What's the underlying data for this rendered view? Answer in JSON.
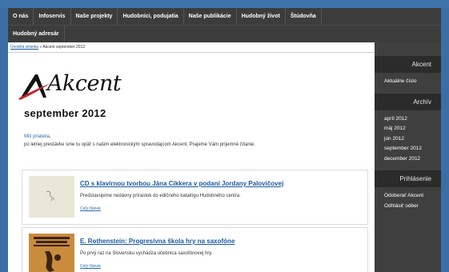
{
  "nav": {
    "row1": [
      "O nás",
      "Infoservis",
      "Naše projekty",
      "Hudobníci, podujatia",
      "Naše publikácie",
      "Hudobný život",
      "Štúdovňa"
    ],
    "row2": [
      "Hudobný adresár"
    ]
  },
  "breadcrumb": {
    "home": "Úvodná stránka",
    "separator": "»",
    "current": "Akcent september 2012"
  },
  "logo": {
    "text": "Akcent"
  },
  "issue_title": "september 2012",
  "intro": {
    "greeting": "Milí priatelia,",
    "text": "po letnej prestávke sme tu opäť s našim elektronickým spravodajcom Akcent. Prajeme Vám príjemné čítanie."
  },
  "articles": [
    {
      "title": "CD s klavírnou tvorbou Jána Cikkera v podaní Jordany Palovičovej",
      "desc": "Predstavujeme nedávny prírastok do edičného katalógu Hudobného centra.",
      "more": "Celý článok"
    },
    {
      "title": "E. Rothenstein: Progresívna škola hry na saxofóne",
      "desc": "Po prvý raz na Slovensku vychádza učebnica saxofónovej hry.",
      "more": "Celý článok"
    }
  ],
  "sidebar": {
    "current_header": "Akcent",
    "current_link": "Aktuálne číslo",
    "archive_header": "Archív",
    "archive_links": [
      "apríl 2012",
      "máj 2012",
      "jún 2012",
      "september 2012",
      "december 2012"
    ],
    "login_header": "Prihlásenie",
    "login_links": [
      "Odoberať Akcent",
      "Odhlásiť odber"
    ]
  },
  "colors": {
    "nav_bg": "#3c3c3c",
    "sidebar_bg": "#3f3f3f",
    "frame": "#3a6ea5",
    "link": "#1a5aa0"
  }
}
